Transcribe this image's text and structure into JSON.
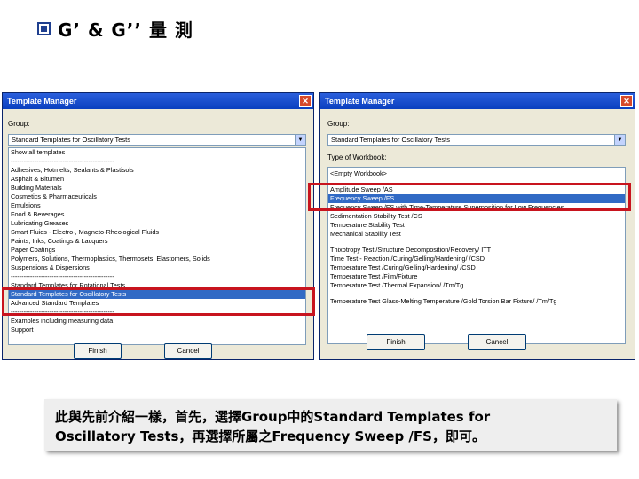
{
  "slide": {
    "title": "G’ & G’’ 量 測"
  },
  "left_dialog": {
    "title": "Template Manager",
    "close": "✕",
    "group_label": "Group:",
    "group_value": "Standard Templates for Oscillatory Tests",
    "group_options": [
      "Show all templates",
      "------------------------------------------------",
      "Adhesives, Hotmelts, Sealants & Plastisols",
      "Asphalt & Bitumen",
      "Building Materials",
      "Cosmetics & Pharmaceuticals",
      "Emulsions",
      "Food & Beverages",
      "Lubricating Greases",
      "Smart Fluids - Electro-, Magneto-Rheological Fluids",
      "Paints, Inks, Coatings & Lacquers",
      "Paper Coatings",
      "Polymers, Solutions, Thermoplastics, Thermosets, Elastomers, Solids",
      "Suspensions & Dispersions",
      "------------------------------------------------",
      "Standard Templates for Rotational Tests",
      "Standard Templates for Oscillatory Tests",
      "Advanced Standard Templates",
      "------------------------------------------------",
      "Examples including measuring data",
      "Support"
    ],
    "selected_index": 16,
    "finish_label": "Finish",
    "cancel_label": "Cancel"
  },
  "right_dialog": {
    "title": "Template Manager",
    "close": "✕",
    "group_label": "Group:",
    "group_value": "Standard Templates for Oscillatory Tests",
    "type_label": "Type of Workbook:",
    "workbook_items_top": [
      "<Empty Workbook>"
    ],
    "workbook_items_mid": [
      "Amplitude Sweep /AS",
      "Frequency Sweep /FS",
      "Frequency Sweep /FS with Time-Temperature Superposition for Low Frequencies",
      "Sedimentation Stability Test /CS",
      "Temperature Stability Test",
      "Mechanical Stability Test"
    ],
    "workbook_items_bottom": [
      "Thixotropy Test /Structure Decomposition/Recovery/ ITT",
      "Time Test - Reaction /Curing/Gelling/Hardening/ /CSD",
      "Temperature Test /Curing/Gelling/Hardening/ /CSD",
      "Temperature Test /Film/Fixture",
      "Temperature Test /Thermal Expansion/ /Tm/Tg"
    ],
    "workbook_items_last": [
      "Temperature Test Glass-Melting Temperature /Gold Torsion Bar Fixture/ /Tm/Tg"
    ],
    "selected_item": "Frequency Sweep /FS",
    "finish_label": "Finish",
    "cancel_label": "Cancel"
  },
  "caption": {
    "line1": "此與先前介紹一樣，首先，選擇Group中的Standard Templates for",
    "line2": "Oscillatory Tests，再選擇所屬之Frequency Sweep /FS，即可。"
  }
}
